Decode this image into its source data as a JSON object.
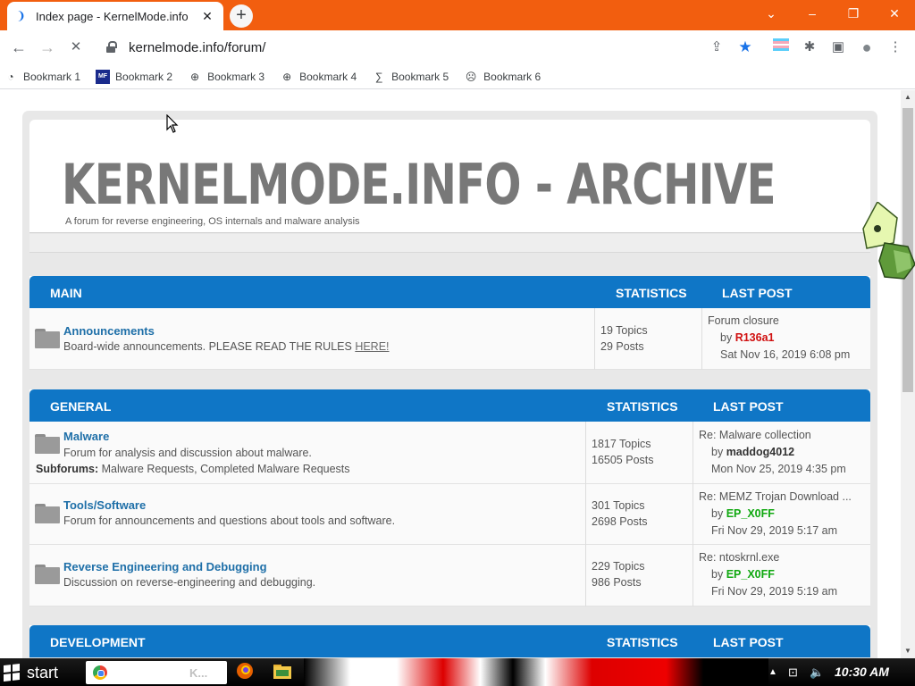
{
  "browser": {
    "tab": {
      "title": "Index page - KernelMode.info",
      "close_glyph": "✕",
      "favicon": "loading-icon"
    },
    "new_tab_glyph": "+",
    "window_controls": {
      "collapse": "⌄",
      "minimize": "–",
      "restore": "❐",
      "close": "✕"
    },
    "toolbar": {
      "back_glyph": "←",
      "forward_glyph": "→",
      "reload_glyph": "✕",
      "url": "kernelmode.info/forum/",
      "share_glyph": "⇪",
      "star_glyph": "★",
      "extensions_glyph": "✱",
      "sidepanel_glyph": "▣",
      "profile_glyph": "●",
      "menu_glyph": "⋮"
    },
    "bookmarks": [
      {
        "label": "Bookmark 1",
        "icon": "bookmark-icon",
        "glyph": "◔"
      },
      {
        "label": "Bookmark 2",
        "icon": "bookmark-icon",
        "glyph": "MF"
      },
      {
        "label": "Bookmark 3",
        "icon": "bookmark-icon",
        "glyph": "⊕"
      },
      {
        "label": "Bookmark 4",
        "icon": "bookmark-icon",
        "glyph": "⊕"
      },
      {
        "label": "Bookmark 5",
        "icon": "bookmark-icon",
        "glyph": "∑"
      },
      {
        "label": "Bookmark 6",
        "icon": "bookmark-icon",
        "glyph": "☹"
      }
    ]
  },
  "page": {
    "site_title": "KERNELMODE.INFO - ARCHIVE",
    "site_description": "A forum for reverse engineering, OS internals and malware analysis",
    "categories": [
      {
        "name": "MAIN",
        "stats_header": "STATISTICS",
        "lastpost_header": "LAST POST",
        "forums": [
          {
            "title": "Announcements",
            "description": "Board-wide announcements. PLEASE READ THE RULES ",
            "description_link": "HERE!",
            "topics": "19 Topics",
            "posts": "29 Posts",
            "last_title": "Forum closure",
            "by_label": "by",
            "last_user": "R136a1",
            "last_date": "Sat Nov 16, 2019 6:08 pm"
          }
        ]
      },
      {
        "name": "GENERAL",
        "stats_header": "STATISTICS",
        "lastpost_header": "LAST POST",
        "forums": [
          {
            "title": "Malware",
            "description": "Forum for analysis and discussion about malware.",
            "subforums_label": "Subforums:",
            "subforums": "Malware Requests, Completed Malware Requests",
            "topics": "1817 Topics",
            "posts": "16505 Posts",
            "last_title": "Re: Malware collection",
            "by_label": "by",
            "last_user": "maddog4012",
            "last_date": "Mon Nov 25, 2019 4:35 pm"
          },
          {
            "title": "Tools/Software",
            "description": "Forum for announcements and questions about tools and software.",
            "topics": "301 Topics",
            "posts": "2698 Posts",
            "last_title": "Re: MEMZ Trojan Download ...",
            "by_label": "by",
            "last_user": "EP_X0FF",
            "last_date": "Fri Nov 29, 2019 5:17 am"
          },
          {
            "title": "Reverse Engineering and Debugging",
            "description": "Discussion on reverse-engineering and debugging.",
            "topics": "229 Topics",
            "posts": "986 Posts",
            "last_title": "Re: ntoskrnl.exe",
            "by_label": "by",
            "last_user": "EP_X0FF",
            "last_date": "Fri Nov 29, 2019 5:19 am"
          }
        ]
      },
      {
        "name": "DEVELOPMENT",
        "stats_header": "STATISTICS",
        "lastpost_header": "LAST POST",
        "forums": []
      }
    ]
  },
  "taskbar": {
    "start_label": "start",
    "task_label": "K...",
    "tray_arrow": "▲",
    "tray_network": "⊡",
    "tray_volume": "🔈",
    "tray_flag": "⚑",
    "clock": "10:30 AM"
  },
  "colors": {
    "tab_strip": "#f25e0f",
    "category_header": "#0f76c6",
    "forum_link": "#1e6fa8",
    "user_red": "#d01010",
    "user_green": "#10a810"
  }
}
